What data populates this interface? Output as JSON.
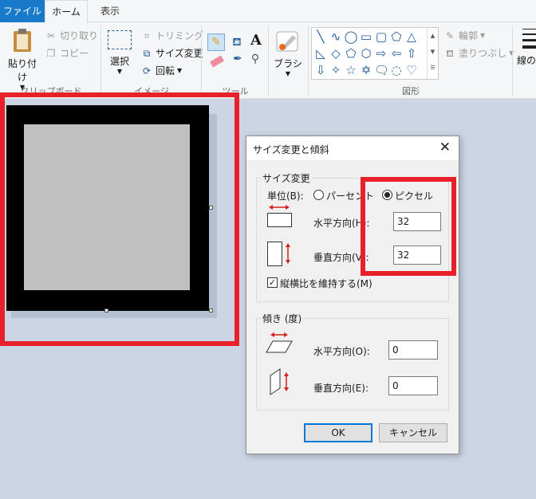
{
  "tabs": {
    "file": "ファイル",
    "home": "ホーム",
    "view": "表示"
  },
  "ribbon": {
    "clipboard": {
      "paste": "貼り付け",
      "cut": "切り取り",
      "copy": "コピー",
      "label": "クリップボード"
    },
    "image": {
      "select": "選択",
      "crop": "トリミング",
      "resize": "サイズ変更",
      "rotate": "回転",
      "label": "イメージ"
    },
    "tools": {
      "label": "ツール"
    },
    "brushes": {
      "label": "ブラシ"
    },
    "shapes": {
      "outline": "輪郭",
      "fill": "塗りつぶし",
      "label": "図形"
    },
    "size": {
      "label": "線の幅"
    }
  },
  "dialog": {
    "title": "サイズ変更と傾斜",
    "resize_group": "サイズ変更",
    "unit_label": "単位(B):",
    "unit_percent": "パーセント",
    "unit_pixel": "ピクセル",
    "horizontal_label": "水平方向(H):",
    "horizontal_value": "32",
    "vertical_label": "垂直方向(V):",
    "vertical_value": "32",
    "keep_ratio": "縦横比を維持する(M)",
    "skew_group": "傾き (度)",
    "skew_h_label": "水平方向(O):",
    "skew_h_value": "0",
    "skew_v_label": "垂直方向(E):",
    "skew_v_value": "0",
    "ok": "OK",
    "cancel": "キャンセル"
  },
  "colors": {
    "file_tab": "#1979ca",
    "highlight": "#e8202a",
    "canvas_bg": "#cbd5e4"
  }
}
